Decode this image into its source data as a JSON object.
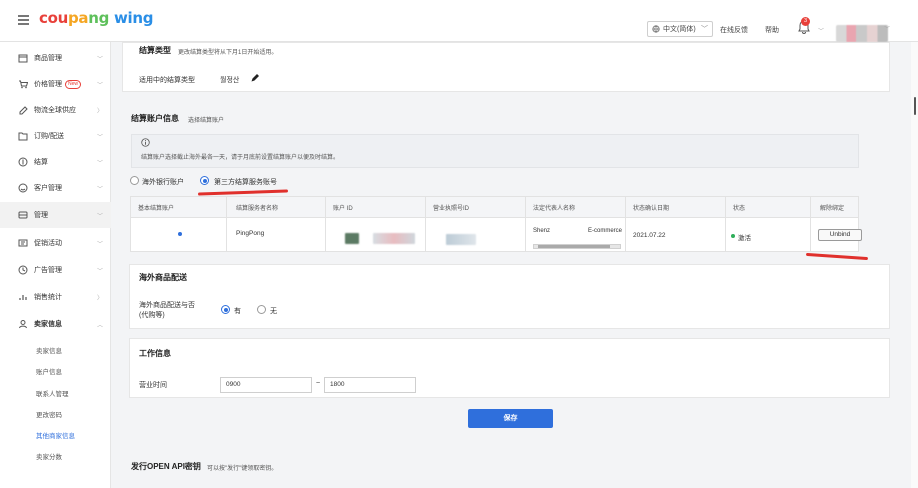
{
  "header": {
    "logo_parts": [
      "cou",
      "pa",
      "ng",
      " wing"
    ],
    "language": "中文(简体)",
    "online_feedback": "在线反馈",
    "help": "帮助",
    "notification_count": "3"
  },
  "sidebar": {
    "items": [
      {
        "label": "商品管理",
        "icon": "box-icon"
      },
      {
        "label": "价格管理",
        "icon": "cart-icon",
        "badge": "New"
      },
      {
        "label": "物流全球供应",
        "icon": "truck-icon"
      },
      {
        "label": "订购/配送",
        "icon": "folder-icon"
      },
      {
        "label": "结算",
        "icon": "coin-icon"
      },
      {
        "label": "客户管理",
        "icon": "smile-icon"
      },
      {
        "label": "管理",
        "icon": "store-icon"
      },
      {
        "label": "促销活动",
        "icon": "promo-icon"
      },
      {
        "label": "广告管理",
        "icon": "ad-icon"
      },
      {
        "label": "销售统计",
        "icon": "chart-icon"
      },
      {
        "label": "卖家信息",
        "icon": "user-icon"
      }
    ],
    "sub_items": [
      "卖家信息",
      "账户信息",
      "联系人管理",
      "更改密码",
      "其他商家信息",
      "卖家分数"
    ],
    "active_sub": "其他商家信息"
  },
  "settlement_type": {
    "title": "结算类型",
    "note": "更改结算类型将从下月1日开始适用。",
    "label": "适用中的结算类型",
    "value": "월정산"
  },
  "account": {
    "title": "结算账户信息",
    "subtitle": "选择结算账户",
    "notice": "结算账户选择截止海外最各一天，请于月底前设置结算账户以便及时结算。",
    "options": [
      "海外银行账户",
      "第三方结算服务账号"
    ],
    "selected": 1,
    "columns": [
      "基本结算账户",
      "结算服务者名称",
      "账户 ID",
      "营业执照号ID",
      "法定代表人名称",
      "状态确认日期",
      "状态",
      "解除绑定"
    ],
    "row": {
      "service": "PingPong",
      "rep_name": "Shenz",
      "rep_company": "E-commerce",
      "date": "2021.07.22",
      "status": "激活",
      "unbind": "Unbind"
    }
  },
  "overseas": {
    "title": "海外商品配送",
    "label": "海外商品配送与否\n(代购等)",
    "options": [
      "有",
      "无"
    ],
    "selected": 0
  },
  "work": {
    "title": "工作信息",
    "label": "营业时间",
    "from": "0900",
    "sep": "~",
    "to": "1800"
  },
  "save_label": "保存",
  "api": {
    "title": "发行OPEN API密钥",
    "note": "可以按\"发行\"键领取密钥。"
  }
}
